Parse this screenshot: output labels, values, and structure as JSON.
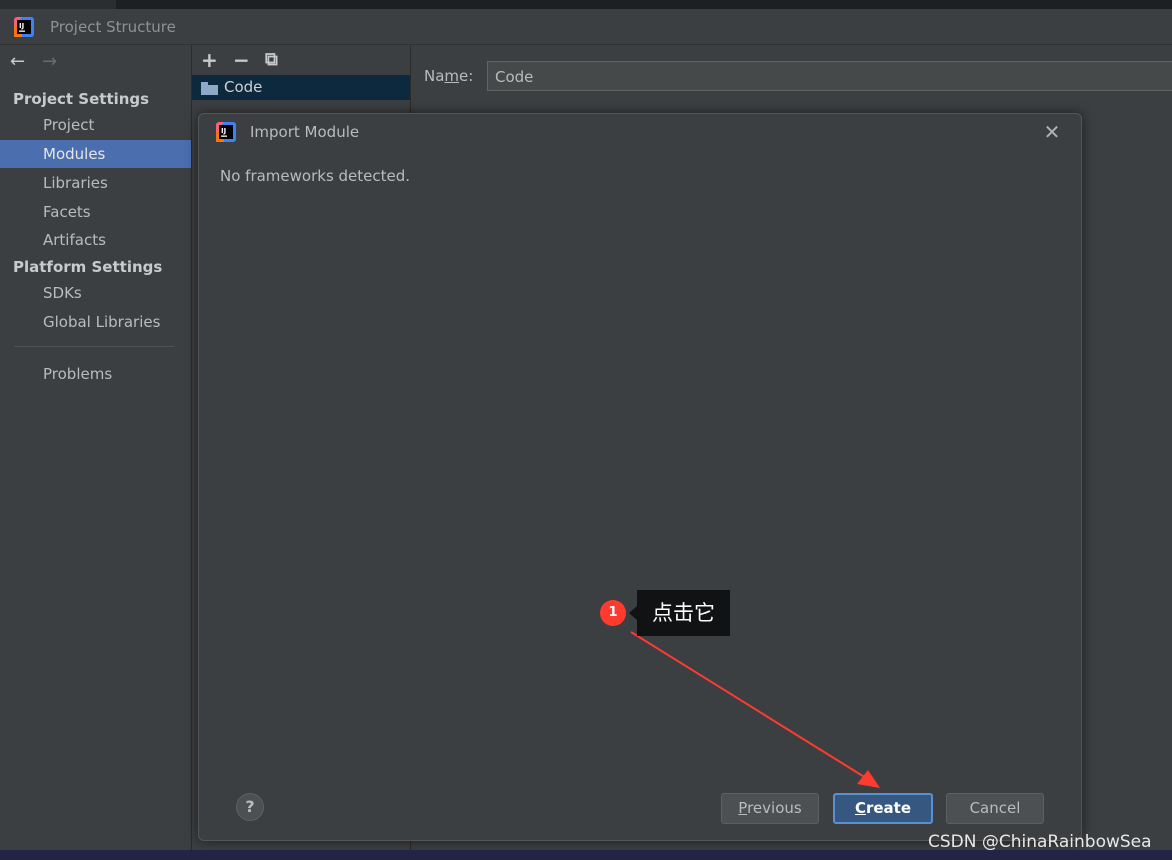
{
  "window": {
    "title": "Project Structure"
  },
  "sidebar": {
    "nav": {
      "back": "←",
      "forward": "→"
    },
    "project_settings_heading": "Project Settings",
    "project_items": [
      {
        "label": "Project",
        "selected": false
      },
      {
        "label": "Modules",
        "selected": true
      },
      {
        "label": "Libraries",
        "selected": false
      },
      {
        "label": "Facets",
        "selected": false
      },
      {
        "label": "Artifacts",
        "selected": false
      }
    ],
    "platform_settings_heading": "Platform Settings",
    "platform_items": [
      {
        "label": "SDKs"
      },
      {
        "label": "Global Libraries"
      }
    ],
    "problems_label": "Problems"
  },
  "module_tree": {
    "toolbar": {
      "add": "+",
      "remove": "−",
      "copy": "⧉"
    },
    "items": [
      {
        "label": "Code",
        "icon": "folder-icon"
      }
    ]
  },
  "details": {
    "name_label_pre": "Na",
    "name_label_mnemonic": "m",
    "name_label_post": "e:",
    "name_value": "Code"
  },
  "dialog": {
    "title": "Import Module",
    "close_glyph": "✕",
    "message": "No frameworks detected.",
    "help_glyph": "?",
    "previous_mnemonic": "P",
    "previous_rest": "revious",
    "create_mnemonic": "C",
    "create_rest": "reate",
    "cancel_label": "Cancel"
  },
  "annotation": {
    "badge_number": "1",
    "tooltip_text": "点击它",
    "color": "#ff3b30"
  },
  "watermark": "CSDN @ChinaRainbowSea",
  "colors": {
    "background": "#3c3f41",
    "selection": "#4b6eaf",
    "default_button": "#365880",
    "tree_selection": "#0d293e"
  }
}
